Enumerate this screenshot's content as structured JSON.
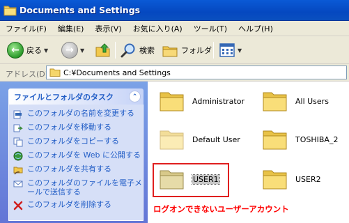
{
  "window": {
    "title": "Documents and Settings",
    "icon": "folder-icon"
  },
  "menu": [
    "ファイル(F)",
    "編集(E)",
    "表示(V)",
    "お気に入り(A)",
    "ツール(T)",
    "ヘルプ(H)"
  ],
  "toolbar": {
    "back_label": "戻る",
    "search_label": "検索",
    "folders_label": "フォルダ"
  },
  "address": {
    "label": "アドレス(D)",
    "path": "C:¥Documents and Settings"
  },
  "tasks": {
    "title": "ファイルとフォルダのタスク",
    "items": [
      {
        "label": "このフォルダの名前を変更する",
        "icon": "rename-icon"
      },
      {
        "label": "このフォルダを移動する",
        "icon": "move-icon"
      },
      {
        "label": "このフォルダをコピーする",
        "icon": "copy-icon"
      },
      {
        "label": "このフォルダを Web に公開する",
        "icon": "web-publish-icon"
      },
      {
        "label": "このフォルダを共有する",
        "icon": "share-icon"
      },
      {
        "label": "このフォルダのファイルを電子メールで送信する",
        "icon": "email-icon"
      },
      {
        "label": "このフォルダを削除する",
        "icon": "delete-icon"
      }
    ]
  },
  "folders": [
    {
      "name": "Administrator"
    },
    {
      "name": "All Users"
    },
    {
      "name": "Default User"
    },
    {
      "name": "TOSHIBA_2"
    },
    {
      "name": "USER1"
    },
    {
      "name": "USER2"
    }
  ],
  "annotation": "ログオンできないユーザーアカウント",
  "colors": {
    "accent": "#215dc6",
    "annotation": "#ff0000",
    "titlebar": "#0548c0"
  }
}
